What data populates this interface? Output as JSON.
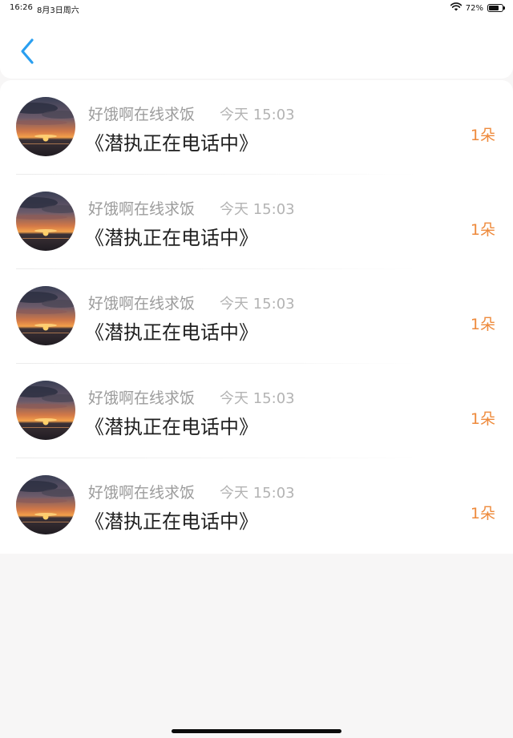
{
  "status_bar": {
    "time": "16:26",
    "date": "8月3日周六",
    "battery_percent": "72%",
    "battery_level": 0.72
  },
  "nav": {
    "back_icon": "chevron-left-icon",
    "accent_color": "#2a9ff0"
  },
  "list": {
    "count_color": "#ee8a3c",
    "items": [
      {
        "name": "好饿啊在线求饭",
        "time": "今天 15:03",
        "message": "《潜执正在电话中》",
        "count": "1朵"
      },
      {
        "name": "好饿啊在线求饭",
        "time": "今天 15:03",
        "message": "《潜执正在电话中》",
        "count": "1朵"
      },
      {
        "name": "好饿啊在线求饭",
        "time": "今天 15:03",
        "message": "《潜执正在电话中》",
        "count": "1朵"
      },
      {
        "name": "好饿啊在线求饭",
        "time": "今天 15:03",
        "message": "《潜执正在电话中》",
        "count": "1朵"
      },
      {
        "name": "好饿啊在线求饭",
        "time": "今天 15:03",
        "message": "《潜执正在电话中》",
        "count": "1朵"
      }
    ]
  }
}
